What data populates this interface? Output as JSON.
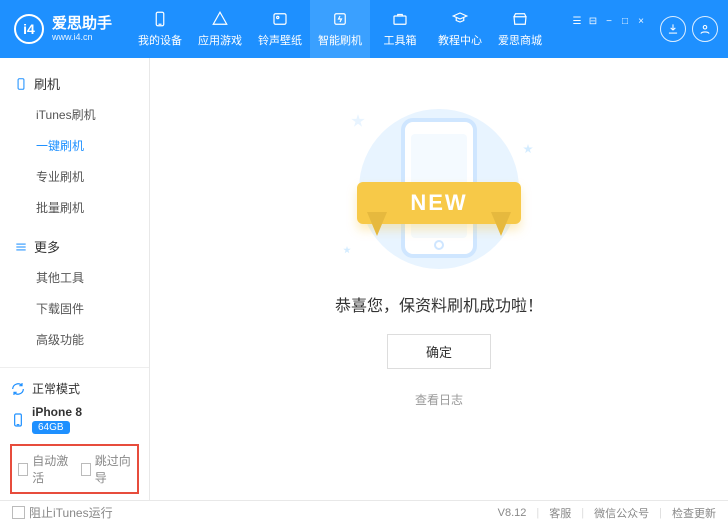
{
  "app": {
    "name": "爱思助手",
    "url": "www.i4.cn",
    "version": "V8.12"
  },
  "nav": [
    {
      "label": "我的设备"
    },
    {
      "label": "应用游戏"
    },
    {
      "label": "铃声壁纸"
    },
    {
      "label": "智能刷机"
    },
    {
      "label": "工具箱"
    },
    {
      "label": "教程中心"
    },
    {
      "label": "爱思商城"
    }
  ],
  "sidebar": {
    "groups": [
      {
        "title": "刷机",
        "items": [
          "iTunes刷机",
          "一键刷机",
          "专业刷机",
          "批量刷机"
        ],
        "active": 1
      },
      {
        "title": "更多",
        "items": [
          "其他工具",
          "下载固件",
          "高级功能"
        ],
        "active": -1
      }
    ],
    "mode": "正常模式",
    "device": {
      "name": "iPhone 8",
      "storage": "64GB"
    },
    "options": {
      "auto_activate": "自动激活",
      "skip_setup": "跳过向导"
    }
  },
  "main": {
    "ribbon": "NEW",
    "title": "恭喜您，保资料刷机成功啦！",
    "confirm": "确定",
    "log": "查看日志"
  },
  "status": {
    "block_itunes": "阻止iTunes运行",
    "items": [
      "客服",
      "微信公众号",
      "检查更新"
    ]
  }
}
